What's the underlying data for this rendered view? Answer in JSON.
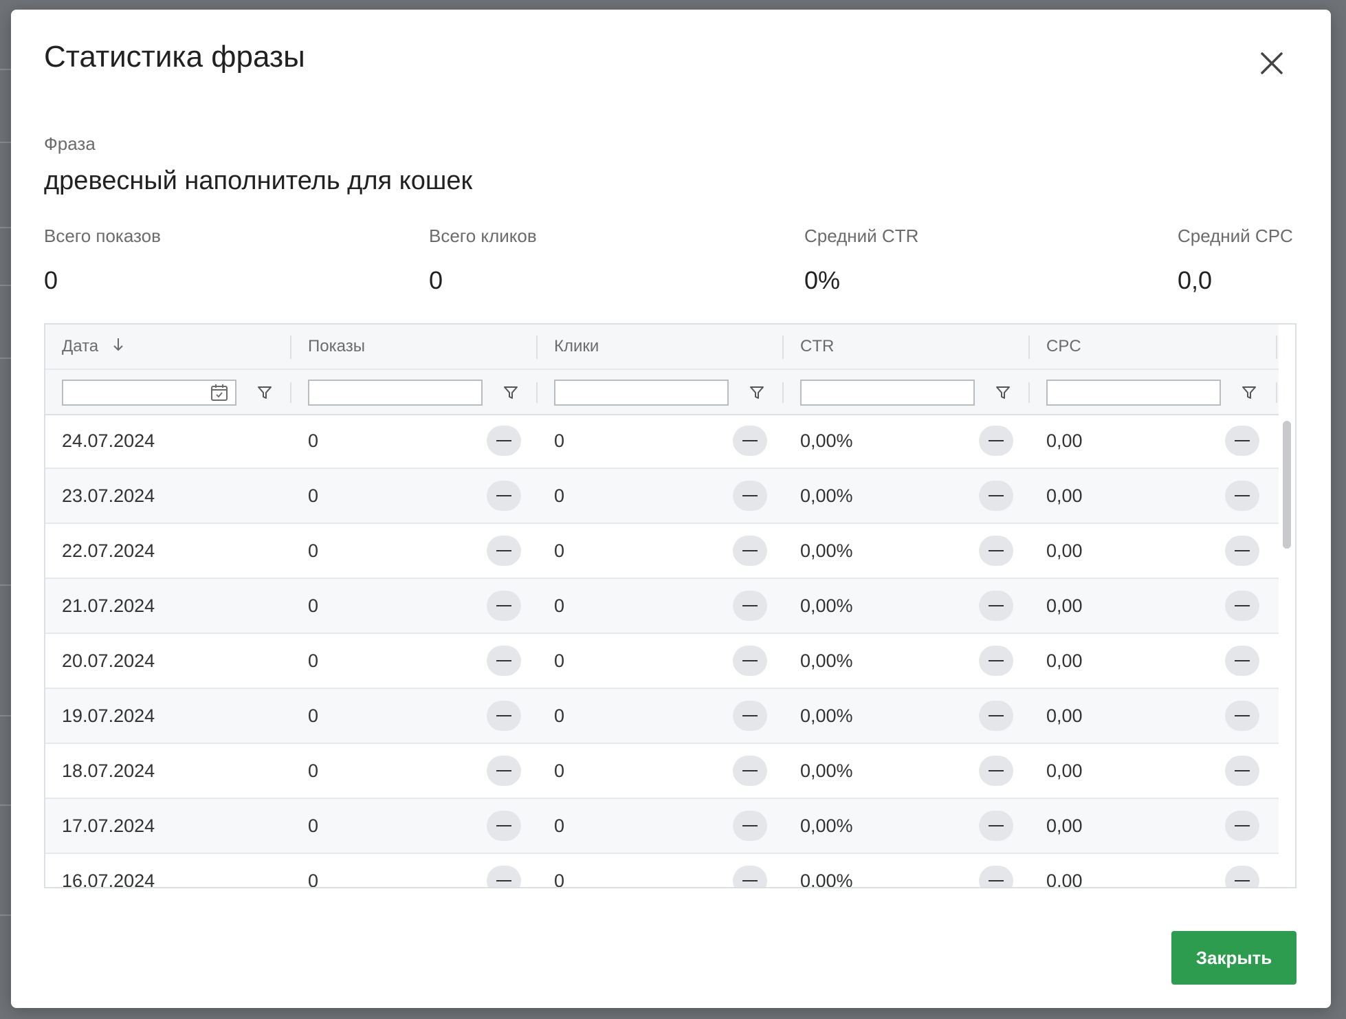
{
  "modal": {
    "title": "Статистика фразы",
    "close_button_label": "Закрыть"
  },
  "phrase": {
    "label": "Фраза",
    "value": "древесный наполнитель для кошек"
  },
  "stats": [
    {
      "label": "Всего показов",
      "value": "0"
    },
    {
      "label": "Всего кликов",
      "value": "0"
    },
    {
      "label": "Средний CTR",
      "value": "0%"
    },
    {
      "label": "Средний CPC",
      "value": "0,0"
    }
  ],
  "table": {
    "columns": [
      "Дата",
      "Показы",
      "Клики",
      "CTR",
      "CPC"
    ],
    "sort": {
      "column": "Дата",
      "direction": "descending"
    },
    "filters": {
      "date": "",
      "shows": "",
      "clicks": "",
      "ctr": "",
      "cpc": ""
    },
    "rows": [
      {
        "date": "24.07.2024",
        "shows": "0",
        "clicks": "0",
        "ctr": "0,00%",
        "cpc": "0,00"
      },
      {
        "date": "23.07.2024",
        "shows": "0",
        "clicks": "0",
        "ctr": "0,00%",
        "cpc": "0,00"
      },
      {
        "date": "22.07.2024",
        "shows": "0",
        "clicks": "0",
        "ctr": "0,00%",
        "cpc": "0,00"
      },
      {
        "date": "21.07.2024",
        "shows": "0",
        "clicks": "0",
        "ctr": "0,00%",
        "cpc": "0,00"
      },
      {
        "date": "20.07.2024",
        "shows": "0",
        "clicks": "0",
        "ctr": "0,00%",
        "cpc": "0,00"
      },
      {
        "date": "19.07.2024",
        "shows": "0",
        "clicks": "0",
        "ctr": "0,00%",
        "cpc": "0,00"
      },
      {
        "date": "18.07.2024",
        "shows": "0",
        "clicks": "0",
        "ctr": "0,00%",
        "cpc": "0,00"
      },
      {
        "date": "17.07.2024",
        "shows": "0",
        "clicks": "0",
        "ctr": "0,00%",
        "cpc": "0,00"
      },
      {
        "date": "16.07.2024",
        "shows": "0",
        "clicks": "0",
        "ctr": "0,00%",
        "cpc": "0,00"
      }
    ]
  },
  "colors": {
    "primary_button": "#2e9c4e",
    "overlay": "#6f7276",
    "header_bg": "#f6f7f8",
    "stripe_bg": "#f7f8fa"
  },
  "icons": [
    "close-icon",
    "sort-down-icon",
    "calendar-icon",
    "filter-icon",
    "minus-icon"
  ]
}
